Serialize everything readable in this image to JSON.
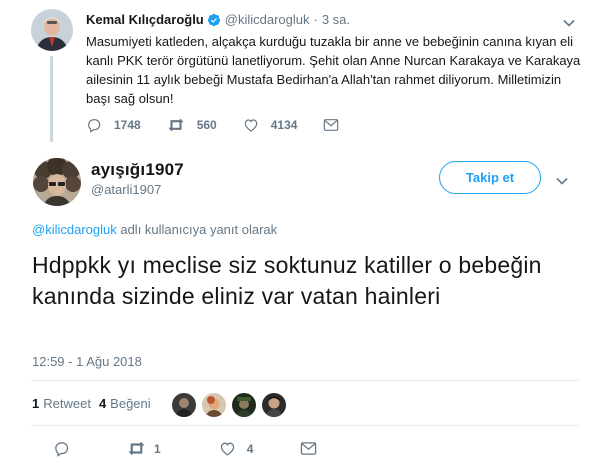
{
  "parent_tweet": {
    "author_name": "Kemal Kılıçdaroğlu",
    "handle": "@kilicdarogluk",
    "separator": "·",
    "time": "3 sa.",
    "text": "Masumiyeti katleden, alçakça kurduğu tuzakla bir anne ve bebeğinin canına kıyan eli kanlı PKK terör örgütünü lanetliyorum. Şehit olan Anne Nurcan Karakaya ve Karakaya ailesinin 11 aylık bebeği Mustafa Bedirhan'a Allah'tan rahmet diliyorum. Milletimizin başı sağ olsun!",
    "replies": "1748",
    "retweets": "560",
    "likes": "4134"
  },
  "reply_tweet": {
    "author_name": "ayışığı1907",
    "handle": "@atarli1907",
    "follow_label": "Takip et",
    "replying_to_mention": "@kilicdarogluk",
    "replying_to_suffix": " adlı kullanıcıya yanıt olarak",
    "text": "Hdppkk yı meclise siz soktunuz katiller o bebeğin kanında sizinde eliniz var vatan hainleri",
    "timestamp": "12:59 - 1 Ağu 2018",
    "retweet_count": "1",
    "retweet_label": "Retweet",
    "like_count": "4",
    "like_label": "Beğeni",
    "action_like_count": "4"
  },
  "colors": {
    "accent": "#1da1f2",
    "muted": "#657786",
    "text": "#14171a"
  }
}
